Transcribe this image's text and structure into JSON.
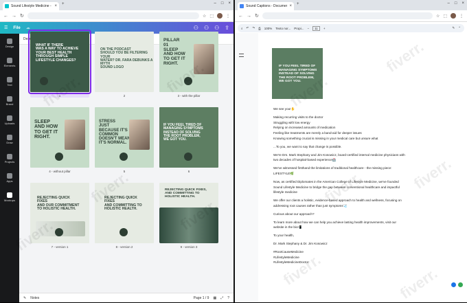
{
  "left_window": {
    "tab_title": "Sound Lifestyle Medicine - ...",
    "canva": {
      "file_label": "File",
      "toolbar": {
        "deselect_label": "Deselect page"
      },
      "rail": [
        "Design",
        "Elements",
        "Text",
        "Brand",
        "Uploads",
        "Draw",
        "Projects",
        "Apps",
        "Mockups"
      ],
      "pages": [
        {
          "label": "1",
          "lines": [
            "WHAT IF THERE",
            "WAS A WAY TO ACHIEVE",
            "YOUR BEST HEALTH",
            "THROUGH SIMPLE",
            "LIFESTYLE CHANGES?"
          ]
        },
        {
          "label": "2",
          "lines": [
            "ON THE PODCAST",
            "Should you be filtering your",
            "water? Dr. Fara debunks a myth",
            "SOUND LOGO"
          ]
        },
        {
          "label": "3 - with the pillar",
          "lines": [
            "PILLAR",
            "01",
            "SLEEP",
            "AND HOW",
            "TO GET IT",
            "RIGHT."
          ]
        },
        {
          "label": "4 - without pillar",
          "lines": [
            "SLEEP",
            "AND HOW",
            "TO GET IT",
            "RIGHT."
          ]
        },
        {
          "label": "5",
          "lines": [
            "STRESS",
            "JUST",
            "BECAUSE IT'S",
            "COMMON",
            "DOESN'T MEAN",
            "IT'S NORMAL."
          ]
        },
        {
          "label": "6",
          "lines": [
            "IF YOU FEEL TIRED OF",
            "MANAGING SYMPTOMS",
            "INSTEAD OF SOLVING",
            "THE ROOT PROBLEM,",
            "WE GOT YOU."
          ]
        },
        {
          "label": "7 - version 1",
          "lines": [
            "REJECTING QUICK",
            "FIXES",
            "AND OUR COMMITMENT",
            "TO HOLISTIC HEALTH."
          ]
        },
        {
          "label": "8 - version 2",
          "lines": [
            "REJECTING QUICK",
            "FIXES",
            "AND COMMITTING TO",
            "HOLISTIC HEALTH."
          ]
        },
        {
          "label": "9 - version 3",
          "lines": [
            "REJECTING QUICK FIXES,",
            "AND COMMITTING TO",
            "HOLISTIC HEALTH."
          ]
        }
      ],
      "footer": {
        "notes_label": "Notes",
        "page_indicator": "Page 1 / 9"
      }
    }
  },
  "right_window": {
    "tab_title": "Sound Captions - Document",
    "docs_toolbar": {
      "zoom": "100%",
      "style": "Texto nor...",
      "font": "Propi...",
      "size": "11"
    },
    "image_lines": [
      "IF YOU FEEL TIRED OF",
      "MANAGING SYMPTOMS",
      "INSTEAD OF SOLVING",
      "THE ROOT PROBLEM,",
      "WE GOT YOU."
    ],
    "doc_lines": [
      "We see you!✋",
      "",
      "Making recurring visits to the doctor",
      "Struggling with low energy",
      "Relying on increased amounts of medication",
      "Feeling like treatments are merely a band-aid for deeper issues",
      "Knowing something crucial is missing in your medical care but unsure what",
      "",
      "...To you, we want to say that change is possible.",
      "",
      "We're Drs. Mark Stephany and Jim Kosowicz, board-certified internal medicine physicians with",
      "two decades of hospital-based experience🏥",
      "",
      "We've witnessed firsthand the limitations of traditional healthcare - the missing piece:",
      "LIFESTYLE🌿",
      "",
      "Now, as certified Diplomates in the American College of Lifestyle Medicine, we've founded",
      "Sound Lifestyle Medicine to bridge the gap between conventional healthcare and impactful",
      "lifestyle medicine",
      "",
      "We offer our clients a holistic, evidence-based approach to health and wellness, focusing on",
      "addressing root causes rather than just symptoms🩺",
      "",
      "Curious about our approach?",
      "",
      "To learn more about how we can help you achieve lasting health improvements, visit our",
      "website in the bio!📱",
      "",
      "To your health,",
      "",
      "Dr. Mark Stephany & Dr. Jim Kosowicz",
      "",
      "#RootCauseMedicine",
      "#LifestyleMedicine",
      "#LifestyleMedicineDoctor"
    ]
  },
  "watermark": "fiverr."
}
